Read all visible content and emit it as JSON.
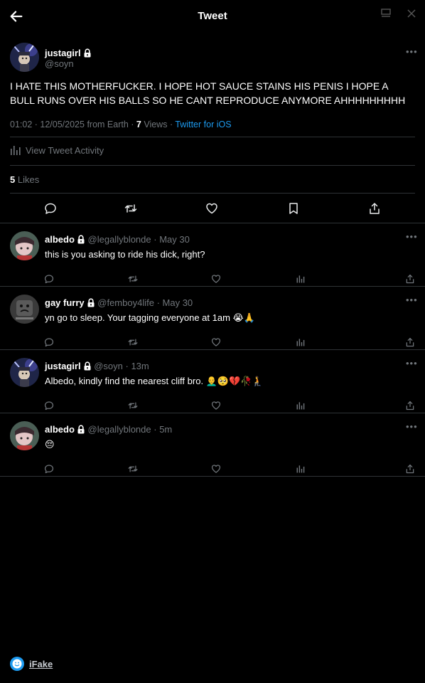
{
  "header": {
    "title": "Tweet",
    "back_icon": "arrow-left-icon",
    "minimize_icon": "window-icon",
    "close_icon": "close-icon"
  },
  "tweet": {
    "author": {
      "name": "justagirl",
      "handle": "@soyn",
      "locked": true
    },
    "text": "I HATE THIS MOTHERFUCKER. I HOPE HOT SAUCE STAINS HIS PENIS I HOPE A BULL RUNS OVER HIS BALLS SO HE CANT REPRODUCE ANYMORE AHHHHHHHHH",
    "time": "01:02",
    "date": "12/05/2025",
    "location": "from Earth",
    "views_count": "7",
    "views_label": "Views",
    "client": "Twitter for iOS",
    "activity_label": "View Tweet Activity",
    "likes_count": "5",
    "likes_label": "Likes"
  },
  "replies": [
    {
      "name": "albedo",
      "handle": "@legallyblonde",
      "time": "May 30",
      "text": "this is you asking to ride his dick, right?"
    },
    {
      "name": "gay furry",
      "handle": "@femboy4life",
      "time": "May 30",
      "text": "yn go to sleep. Your tagging everyone at 1am 😭🙏"
    },
    {
      "name": "justagirl",
      "handle": "@soyn",
      "time": "13m",
      "text": "Albedo, kindly find the nearest cliff bro. 👨‍🦲🥺💔🥀🧎"
    },
    {
      "name": "albedo",
      "handle": "@legallyblonde",
      "time": "5m",
      "text": "😔"
    }
  ],
  "footer": {
    "brand": "iFake"
  },
  "colors": {
    "background": "#000000",
    "text": "#e7e9ea",
    "secondary": "#71767b",
    "accent": "#1d9bf0",
    "divider": "#2f3336"
  }
}
